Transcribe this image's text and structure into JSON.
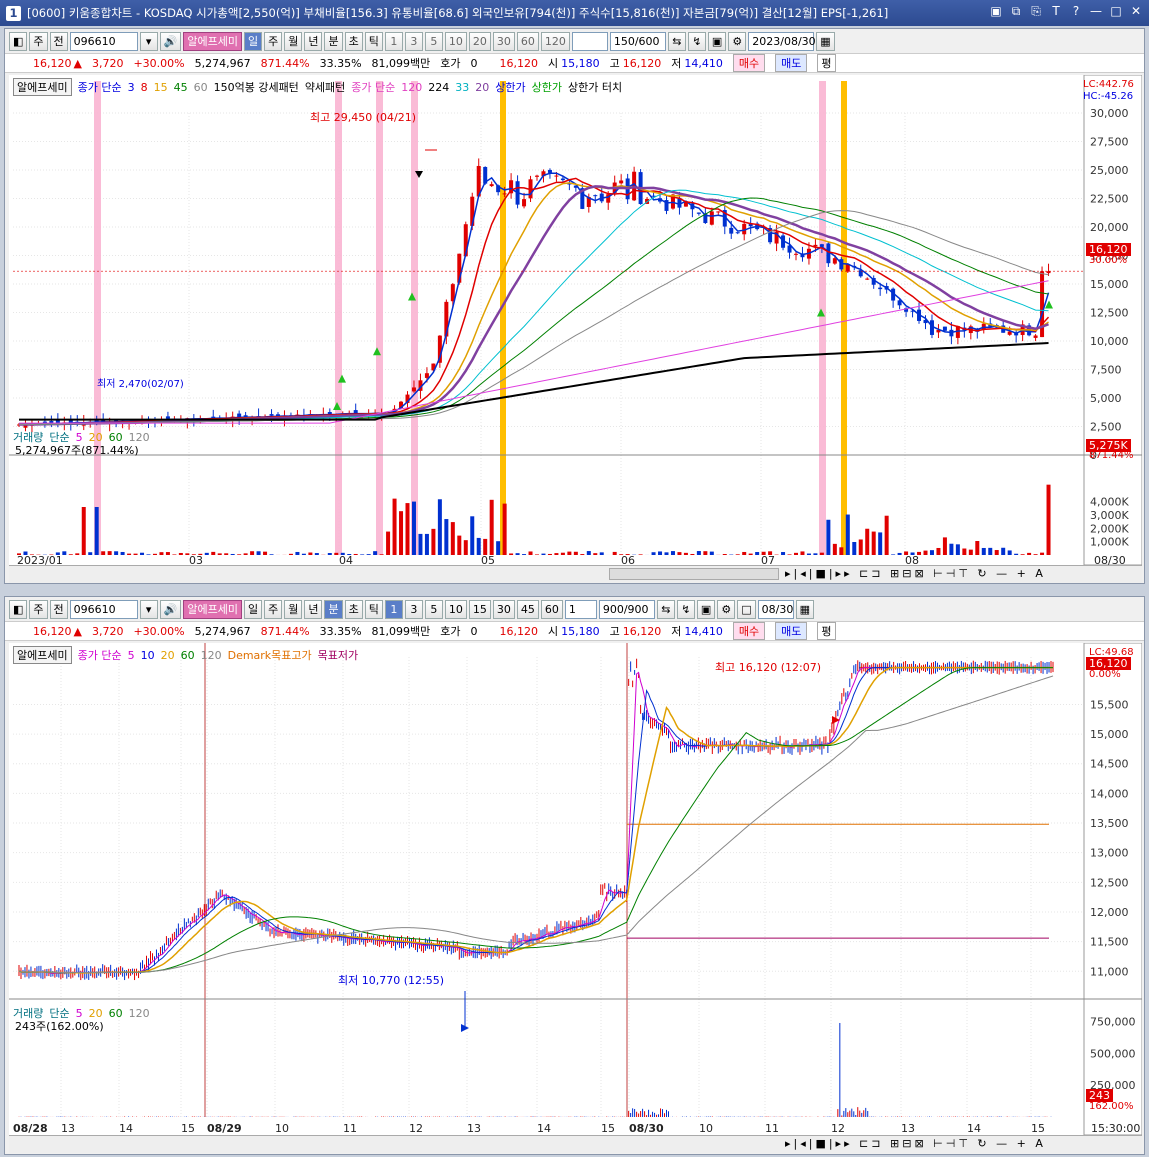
{
  "window": {
    "num": "1",
    "title": "[0600] 키움종합차트 - KOSDAQ 시가총액[2,550(억)] 부채비율[156.3] 유통비율[68.6] 외국인보유[794(천)] 주식수[15,816(천)] 자본금[79(억)] 결산[12월] EPS[-1,261]",
    "controls": [
      "▣",
      "⧉",
      "⎘",
      "T",
      "?",
      "—",
      "□",
      "✕"
    ]
  },
  "top": {
    "toolbar": {
      "type": "주",
      "prev": "전",
      "code": "096610",
      "name": "알에프세미",
      "mode_active": "일",
      "modes": [
        "일",
        "주",
        "월",
        "년",
        "분",
        "초",
        "틱"
      ],
      "nums": [
        "1",
        "3",
        "5",
        "10",
        "20",
        "30",
        "60",
        "120"
      ],
      "count": "150/600",
      "date": "2023/08/30"
    },
    "quote": {
      "price": "16,120",
      "arrow": "▲",
      "change": "3,720",
      "pct": "+30.00%",
      "volume": "5,274,967",
      "vol_pct": "871.44%",
      "turn": "33.35%",
      "amount": "81,099백만",
      "hoga_label": "호가",
      "hoga": "0",
      "cur": "16,120",
      "open_l": "시",
      "open": "15,180",
      "high_l": "고",
      "high": "16,120",
      "low_l": "저",
      "low": "14,410",
      "buy": "매수",
      "sell": "매도",
      "flat": "평"
    },
    "legend": {
      "name": "알에프세미",
      "ma_label": "종가 단순",
      "ma": [
        "3",
        "8",
        "15",
        "45",
        "60"
      ],
      "pattern": "150억봉 강세패턴",
      "weak": "약세패턴",
      "ma2_label": "종가 단순",
      "ma2": [
        "120",
        "224",
        "33",
        "20"
      ],
      "upper": "상한가",
      "upper2": "상한가",
      "upper3": "상한가 터치"
    },
    "yaxis": [
      "30,000",
      "27,500",
      "25,000",
      "22,500",
      "20,000",
      "17,500",
      "15,000",
      "12,500",
      "10,000",
      "7,500",
      "5,000",
      "2,500",
      "0"
    ],
    "lc": "LC:442.76",
    "hc": "HC:-45.26",
    "tag_price": "16,120",
    "tag_pct": "30.00%",
    "high_note": "최고 29,450 (04/21)",
    "low_note": "최저 2,470(02/07)",
    "vol_legend": {
      "label": "거래량",
      "ma_label": "단순",
      "ma": [
        "5",
        "20",
        "60",
        "120"
      ],
      "value": "5,274,967주(871.44%)"
    },
    "vol_axis": [
      "4,000K",
      "3,000K",
      "2,000K",
      "1,000K"
    ],
    "vol_tag": "5,275K",
    "vol_tag_pct": "871.44%",
    "xaxis": [
      "2023/01",
      "03",
      "04",
      "05",
      "06",
      "07",
      "08",
      "08/30"
    ]
  },
  "bottom": {
    "toolbar": {
      "type": "주",
      "prev": "전",
      "code": "096610",
      "name": "알에프세미",
      "mode_active": "분",
      "modes": [
        "일",
        "주",
        "월",
        "년",
        "분",
        "초",
        "틱"
      ],
      "nums_active": "1",
      "nums": [
        "1",
        "3",
        "5",
        "10",
        "15",
        "30",
        "45",
        "60"
      ],
      "sel": "1",
      "count": "900/900",
      "date": "08/30"
    },
    "quote": {
      "price": "16,120",
      "arrow": "▲",
      "change": "3,720",
      "pct": "+30.00%",
      "volume": "5,274,967",
      "vol_pct": "871.44%",
      "turn": "33.35%",
      "amount": "81,099백만",
      "hoga_label": "호가",
      "hoga": "0",
      "cur": "16,120",
      "open_l": "시",
      "open": "15,180",
      "high_l": "고",
      "high": "16,120",
      "low_l": "저",
      "low": "14,410",
      "buy": "매수",
      "sell": "매도",
      "flat": "평"
    },
    "legend": {
      "name": "알에프세미",
      "ma_label": "종가 단순",
      "ma": [
        "5",
        "10",
        "20",
        "60",
        "120"
      ],
      "demark_hi": "Demark목표고가",
      "demark_lo": "목표저가"
    },
    "yaxis": [
      "15,500",
      "15,000",
      "14,500",
      "14,000",
      "13,500",
      "13,000",
      "12,500",
      "12,000",
      "11,500",
      "11,000"
    ],
    "lc": "LC:49.68",
    "tag_price": "16,120",
    "tag_pct": "0.00%",
    "high_note": "최고 16,120 (12:07)",
    "low_note": "최저 10,770 (12:55)",
    "vol_legend": {
      "label": "거래량",
      "ma_label": "단순",
      "ma": [
        "5",
        "20",
        "60",
        "120"
      ],
      "value": "243주(162.00%)"
    },
    "vol_axis": [
      "750,000",
      "500,000",
      "250,000"
    ],
    "vol_tag": "243",
    "vol_tag_pct": "162.00%",
    "xaxis": [
      "08/28",
      "13",
      "14",
      "15",
      "08/29",
      "10",
      "11",
      "12",
      "13",
      "14",
      "15",
      "08/30",
      "10",
      "11",
      "12",
      "13",
      "14",
      "15",
      "15:30:00"
    ]
  },
  "colors": {
    "up": "#e00000",
    "down": "#0030d0",
    "pink": "#f9b4d2",
    "gold": "#ffbe00"
  }
}
